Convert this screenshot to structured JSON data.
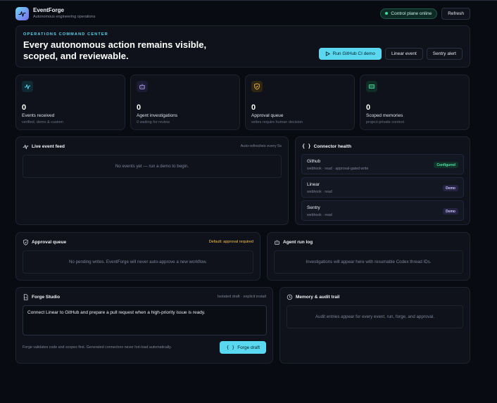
{
  "app": {
    "name": "EventForge",
    "subtitle": "Autonomous engineering operations",
    "status": "Control plane online",
    "refresh_label": "Refresh"
  },
  "hero": {
    "eyebrow": "OPERATIONS COMMAND CENTER",
    "title": "Every autonomous action remains visible, scoped, and reviewable.",
    "actions": [
      "Run GitHub CI demo",
      "Linear event",
      "Sentry alert"
    ]
  },
  "stats": [
    {
      "value": "0",
      "label": "Events received",
      "sub": "verified, demo & custom",
      "icon": "pulse-icon",
      "color": "#5ad8f0"
    },
    {
      "value": "0",
      "label": "Agent investigations",
      "sub": "0 waiting for review",
      "icon": "bot-icon",
      "color": "#b8a8ff"
    },
    {
      "value": "0",
      "label": "Approval queue",
      "sub": "writes require human decision",
      "icon": "shield-icon",
      "color": "#f4c04a"
    },
    {
      "value": "0",
      "label": "Scoped memories",
      "sub": "project-private context",
      "icon": "memory-icon",
      "color": "#53e1a6"
    }
  ],
  "feed": {
    "title": "Live event feed",
    "meta": "Auto-refreshes every 5s",
    "empty": "No events yet — run a demo to begin."
  },
  "connectors": {
    "title": "Connector health",
    "items": [
      {
        "name": "Github",
        "meta": "webhook · read · approval-gated write",
        "badge": "Configured"
      },
      {
        "name": "Linear",
        "meta": "webhook · read",
        "badge": "Demo"
      },
      {
        "name": "Sentry",
        "meta": "webhook · read",
        "badge": "Demo"
      }
    ]
  },
  "approval": {
    "title": "Approval queue",
    "meta": "Default: approval required",
    "empty": "No pending writes. EventForge will never auto-approve a new workflow."
  },
  "runlog": {
    "title": "Agent run log",
    "empty": "Investigations will appear here with resumable Codex thread IDs."
  },
  "forge": {
    "title": "Forge Studio",
    "meta": "Isolated draft · explicit install",
    "input_value": "Connect Linear to GitHub and prepare a pull request when a high-priority issue is ready.",
    "footer": "Forge validates code and scopes first. Generated connectors never hot-load automatically.",
    "button": "Forge draft"
  },
  "memory": {
    "title": "Memory & audit trail",
    "empty": "Audit entries appear for every event, run, forge, and approval."
  }
}
